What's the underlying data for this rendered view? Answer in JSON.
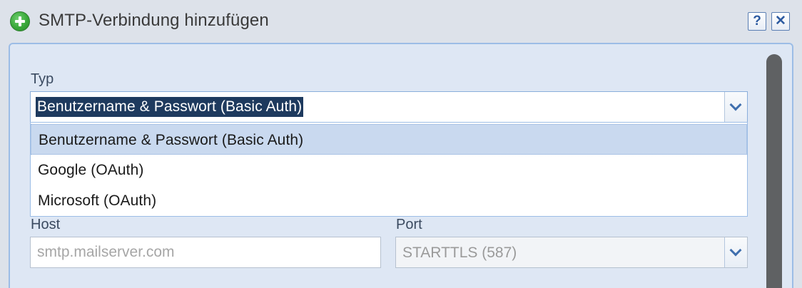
{
  "window": {
    "title": "SMTP-Verbindung hinzufügen",
    "help_label": "?",
    "close_label": "✕"
  },
  "form": {
    "typ": {
      "label": "Typ",
      "selected": "Benutzername & Passwort (Basic Auth)",
      "options": [
        "Benutzername & Passwort (Basic Auth)",
        "Google (OAuth)",
        "Microsoft (OAuth)"
      ]
    },
    "host": {
      "label": "Host",
      "value": "",
      "placeholder": "smtp.mailserver.com"
    },
    "port": {
      "label": "Port",
      "selected": "STARTTLS (587)"
    }
  },
  "colors": {
    "accent": "#3f6fae",
    "selection_bg": "#1e3a5e",
    "option_highlight": "#c9d9ef",
    "add_icon": "#3aa83a"
  },
  "icons": {
    "title": "plus-circle-icon",
    "dropdown": "chevron-down-icon"
  }
}
